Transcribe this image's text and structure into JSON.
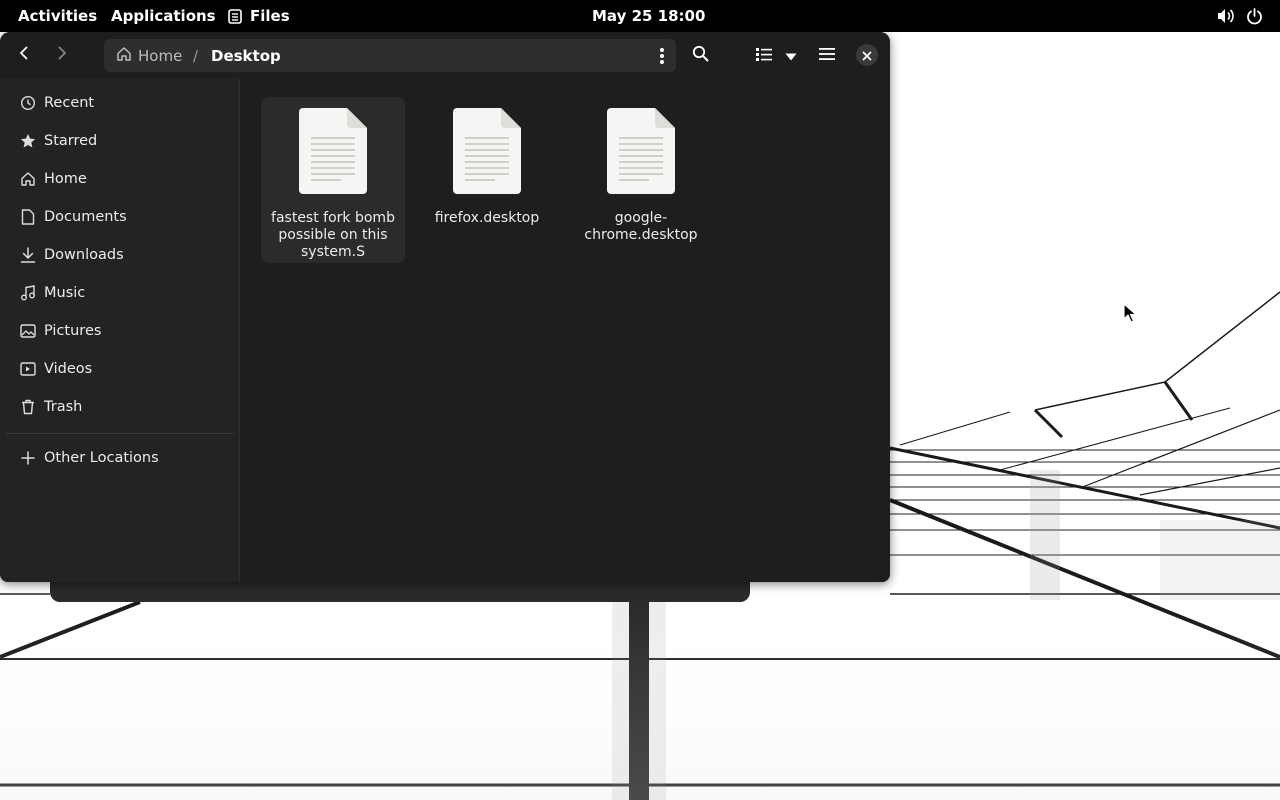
{
  "topbar": {
    "activities": "Activities",
    "applications": "Applications",
    "app_name": "Files",
    "clock": "May 25  18:00",
    "icons": [
      "files-app-icon",
      "volume-icon",
      "power-icon"
    ]
  },
  "window": {
    "header": {
      "breadcrumb": [
        "Home",
        "Desktop"
      ],
      "separator": "/",
      "icons": [
        "back-icon",
        "forward-icon",
        "home-icon",
        "kebab-menu-icon",
        "search-icon",
        "list-view-icon",
        "chevron-down-icon",
        "hamburger-menu-icon",
        "close-icon"
      ]
    },
    "sidebar": {
      "items": [
        {
          "label": "Recent",
          "icon": "clock-icon"
        },
        {
          "label": "Starred",
          "icon": "star-icon"
        },
        {
          "label": "Home",
          "icon": "home-icon"
        },
        {
          "label": "Documents",
          "icon": "document-icon"
        },
        {
          "label": "Downloads",
          "icon": "download-icon"
        },
        {
          "label": "Music",
          "icon": "music-icon"
        },
        {
          "label": "Pictures",
          "icon": "picture-icon"
        },
        {
          "label": "Videos",
          "icon": "video-icon"
        },
        {
          "label": "Trash",
          "icon": "trash-icon"
        }
      ],
      "other_locations": {
        "label": "Other Locations",
        "icon": "plus-icon"
      }
    },
    "files": [
      {
        "name": "fastest fork bomb possible on this system.S",
        "selected": true,
        "icon": "text-file-icon"
      },
      {
        "name": "firefox.desktop",
        "selected": false,
        "icon": "text-file-icon"
      },
      {
        "name": "google-chrome.desktop",
        "selected": false,
        "icon": "text-file-icon"
      }
    ]
  },
  "colors": {
    "topbar_bg": "#000000",
    "window_bg": "#1e1e1e",
    "sidebar_bg": "#232323",
    "selection_bg": "#2b2b2b",
    "pathbar_bg": "#2e2e2e"
  }
}
